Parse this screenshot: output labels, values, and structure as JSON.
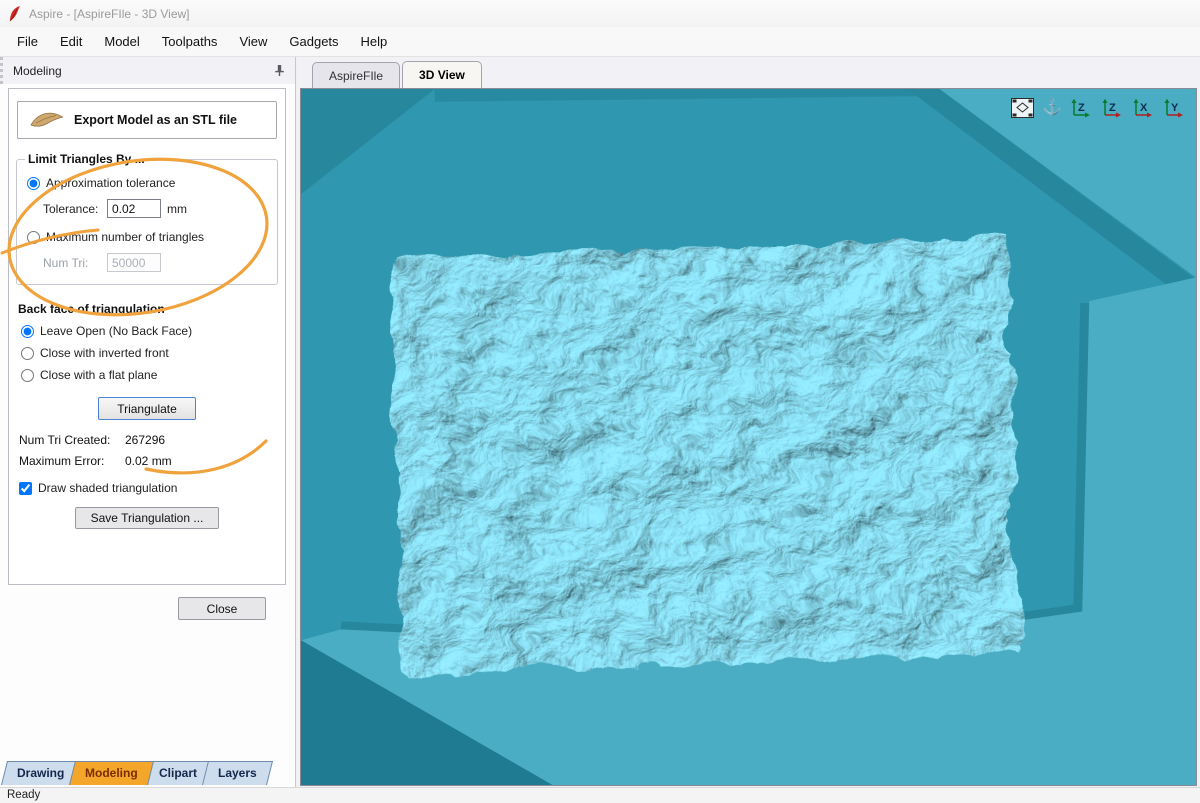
{
  "window": {
    "title": "Aspire - [AspireFIle - 3D View]"
  },
  "menu": {
    "items": [
      "File",
      "Edit",
      "Model",
      "Toolpaths",
      "View",
      "Gadgets",
      "Help"
    ]
  },
  "panel": {
    "title": "Modeling",
    "export_button": "Export Model as an STL file",
    "limit_group": {
      "title": "Limit Triangles By ...",
      "radio_tolerance": "Approximation tolerance",
      "tolerance_label": "Tolerance:",
      "tolerance_value": "0.02",
      "tolerance_unit": "mm",
      "radio_max_triangles": "Maximum number of triangles",
      "num_tri_label": "Num Tri:",
      "num_tri_value": "50000"
    },
    "backface_group": {
      "title": "Back face of triangulation",
      "options": [
        "Leave Open (No Back Face)",
        "Close with inverted front",
        "Close with a flat plane"
      ]
    },
    "triangulate_button": "Triangulate",
    "num_tri_created_label": "Num Tri Created:",
    "num_tri_created_value": "267296",
    "max_error_label": "Maximum Error:",
    "max_error_value": "0.02 mm",
    "draw_shaded_label": "Draw shaded triangulation",
    "save_button": "Save Triangulation ...",
    "close_button": "Close"
  },
  "view_tabs": [
    {
      "label": "AspireFIle"
    },
    {
      "label": "3D View"
    }
  ],
  "viewport": {
    "icons": [
      {
        "name": "fit-view"
      },
      {
        "name": "pan-anchor",
        "glyph": "⚓"
      },
      {
        "name": "axis-z-iso",
        "letter": "Z"
      },
      {
        "name": "axis-z",
        "letter": "Z"
      },
      {
        "name": "axis-x",
        "letter": "X"
      },
      {
        "name": "axis-y",
        "letter": "Y"
      }
    ]
  },
  "bottom_tabs": [
    "Drawing",
    "Modeling",
    "Clipart",
    "Layers"
  ],
  "status": {
    "text": "Ready"
  },
  "colors": {
    "annotation": "#F0A23C",
    "floor": "#2F97AF",
    "rim": "#4BADC3",
    "wall": "#27879D",
    "terrain_highlight": "#93EAFF",
    "modeling_tab": "#F3A62A"
  }
}
